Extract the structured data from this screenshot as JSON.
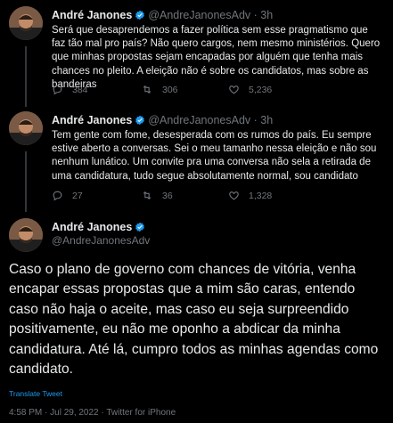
{
  "tweets": [
    {
      "name": "André Janones",
      "handle": "@AndreJanonesAdv",
      "separator": "·",
      "time": "3h",
      "text": "Será que desaprendemos a fazer política sem esse pragmatismo que faz tão mal pro país? Não quero cargos, nem mesmo ministérios. Quero que minhas propostas sejam encapadas por alguém que tenha mais chances no pleito. A eleição não é sobre os candidatos, mas sobre as bandeiras",
      "replies": "384",
      "retweets": "306",
      "likes": "5,236"
    },
    {
      "name": "André Janones",
      "handle": "@AndreJanonesAdv",
      "separator": "·",
      "time": "3h",
      "text": "Tem gente com fome, desesperada com os rumos do país. Eu sempre estive aberto a conversas. Sei o meu tamanho nessa eleição e não sou nenhum lunático. Um convite pra uma conversa não sela a retirada de uma candidatura, tudo segue absolutamente normal, sou candidato",
      "replies": "27",
      "retweets": "36",
      "likes": "1,328"
    }
  ],
  "main": {
    "name": "André Janones",
    "handle": "@AndreJanonesAdv",
    "text": "Caso o plano de governo com chances de vitória, venha encapar essas propostas que a mim são caras, entendo caso não haja o aceite, mas caso eu seja surpreendido positivamente, eu não me oponho a abdicar da minha candidatura. Até lá, cumpro todos as minhas agendas como candidato.",
    "translate": "Translate Tweet",
    "meta": "4:58 PM · Jul 29, 2022 · Twitter for iPhone"
  },
  "colors": {
    "background": "#000000",
    "text": "#e7e9ea",
    "muted": "#71767b",
    "link": "#1d9bf0",
    "verified": "#1d9bf0"
  },
  "icons": [
    "avatar",
    "verified-badge-icon",
    "reply-icon",
    "retweet-icon",
    "like-icon"
  ]
}
